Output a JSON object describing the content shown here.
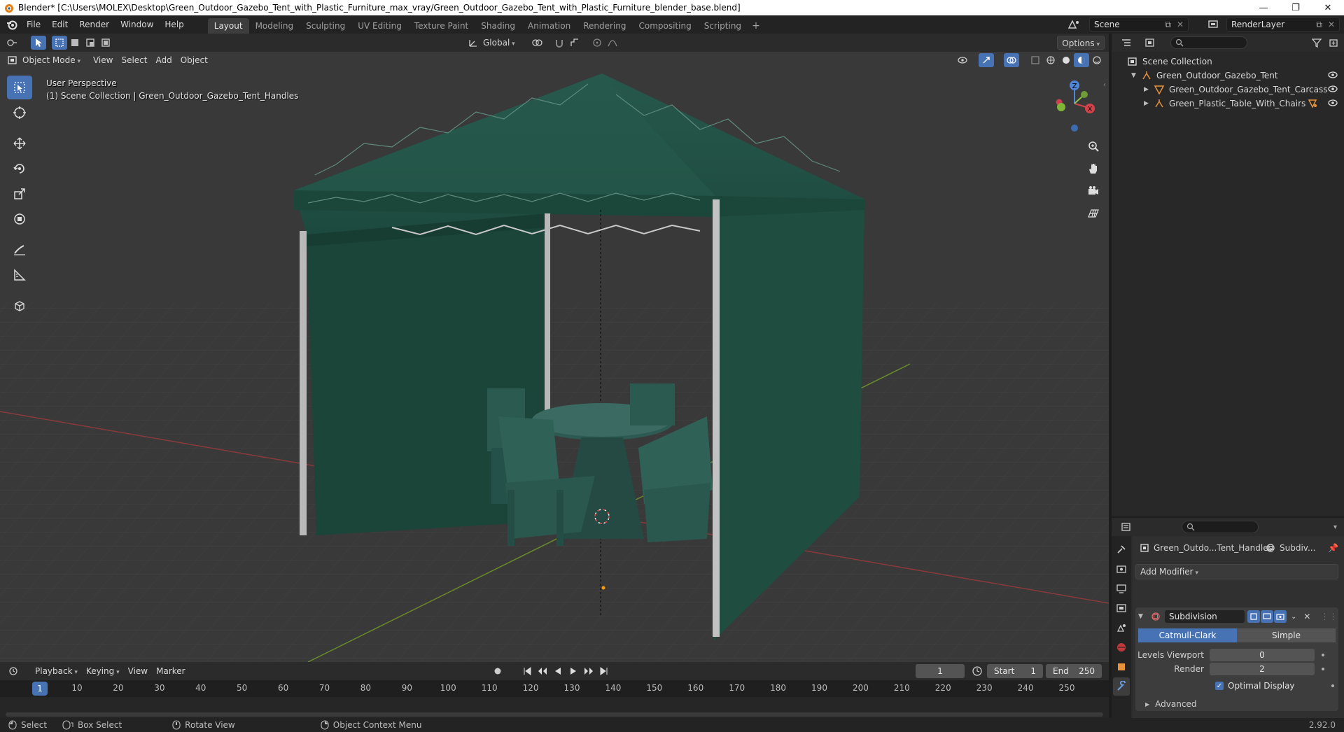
{
  "window": {
    "title": "Blender* [C:\\Users\\MOLEX\\Desktop\\Green_Outdoor_Gazebo_Tent_with_Plastic_Furniture_max_vray/Green_Outdoor_Gazebo_Tent_with_Plastic_Furniture_blender_base.blend]",
    "minimize": "—",
    "maximize": "❐",
    "close": "✕"
  },
  "menu": {
    "items": [
      "File",
      "Edit",
      "Render",
      "Window",
      "Help"
    ]
  },
  "workspaces": {
    "tabs": [
      "Layout",
      "Modeling",
      "Sculpting",
      "UV Editing",
      "Texture Paint",
      "Shading",
      "Animation",
      "Rendering",
      "Compositing",
      "Scripting"
    ],
    "active": "Layout",
    "add": "+"
  },
  "scene": {
    "name": "Scene",
    "view_layer": "RenderLayer"
  },
  "viewport": {
    "header": {
      "mode": "Object Mode",
      "menus": [
        "View",
        "Select",
        "Add",
        "Object"
      ],
      "orientation": "Global",
      "options": "Options"
    },
    "info_line1": "User Perspective",
    "info_line2": "(1) Scene Collection | Green_Outdoor_Gazebo_Tent_Handles",
    "gizmo": {
      "z": "Z",
      "x": "X",
      "y": "Y"
    }
  },
  "outliner": {
    "root": "Scene Collection",
    "items": [
      {
        "label": "Green_Outdoor_Gazebo_Tent",
        "level": 1,
        "expanded": true,
        "icon": "empty-icon"
      },
      {
        "label": "Green_Outdoor_Gazebo_Tent_Carcass",
        "level": 2,
        "expanded": false,
        "icon": "mesh-icon"
      },
      {
        "label": "Green_Plastic_Table_With_Chairs",
        "level": 2,
        "expanded": false,
        "icon": "empty-icon"
      }
    ]
  },
  "properties": {
    "object_name": "Green_Outdo...Tent_Handles",
    "modifier_short": "Subdiv...",
    "add_modifier": "Add Modifier",
    "modifier": {
      "name": "Subdivision",
      "types": [
        "Catmull-Clark",
        "Simple"
      ],
      "active_type": "Catmull-Clark",
      "levels_viewport_label": "Levels Viewport",
      "levels_viewport": "0",
      "render_label": "Render",
      "render": "2",
      "optimal_display_label": "Optimal Display",
      "optimal_display": true,
      "advanced_label": "Advanced"
    }
  },
  "timeline": {
    "menus": [
      "Playback",
      "Keying",
      "View",
      "Marker"
    ],
    "current_frame": "1",
    "start_label": "Start",
    "start": "1",
    "end_label": "End",
    "end": "250",
    "ruler": [
      "1",
      "10",
      "20",
      "30",
      "40",
      "50",
      "60",
      "70",
      "80",
      "90",
      "100",
      "110",
      "120",
      "130",
      "140",
      "150",
      "160",
      "170",
      "180",
      "190",
      "200",
      "210",
      "220",
      "230",
      "240",
      "250"
    ]
  },
  "statusbar": {
    "select": "Select",
    "box_select": "Box Select",
    "rotate_view": "Rotate View",
    "context_menu": "Object Context Menu",
    "version": "2.92.0"
  },
  "colors": {
    "accent": "#4772b3",
    "viewport_bg": "#393939",
    "tent_green": "#1f4d40"
  }
}
